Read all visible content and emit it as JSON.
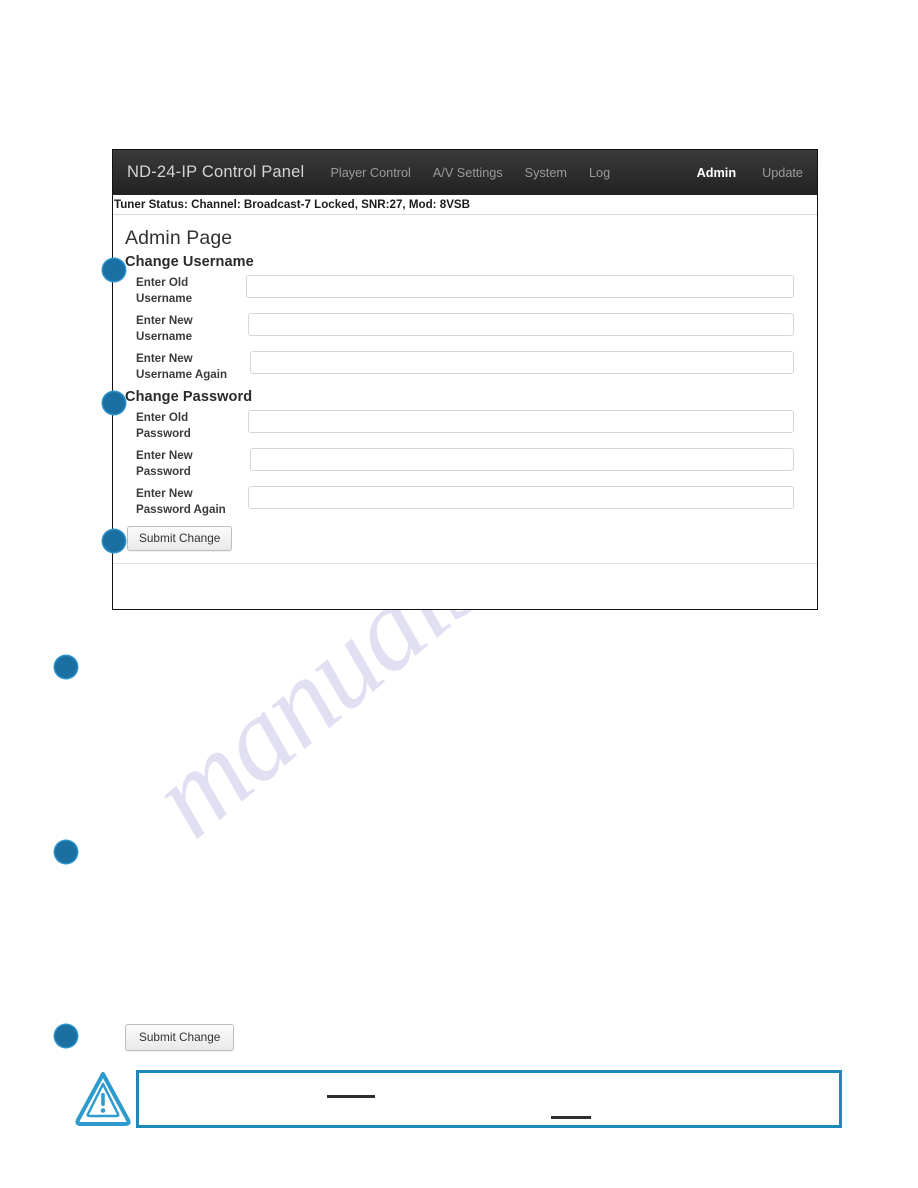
{
  "navbar": {
    "brand": "ND-24-IP Control Panel",
    "items": [
      {
        "label": "Player Control",
        "active": false
      },
      {
        "label": "A/V Settings",
        "active": false
      },
      {
        "label": "System",
        "active": false
      },
      {
        "label": "Log",
        "active": false
      }
    ],
    "right_items": [
      {
        "label": "Admin",
        "active": true
      },
      {
        "label": "Update",
        "active": false
      }
    ]
  },
  "statusbar": {
    "text": "Tuner Status: Channel: Broadcast-7 Locked, SNR:27, Mod: 8VSB"
  },
  "page": {
    "title": "Admin Page"
  },
  "sections": {
    "username": {
      "title": "Change Username",
      "fields": [
        {
          "label": "Enter Old Username",
          "value": "",
          "placeholder": ""
        },
        {
          "label": "Enter New Username",
          "value": "",
          "placeholder": ""
        },
        {
          "label": "Enter New Username Again",
          "value": "",
          "placeholder": ""
        }
      ]
    },
    "password": {
      "title": "Change Password",
      "fields": [
        {
          "label": "Enter Old Password",
          "value": "",
          "placeholder": ""
        },
        {
          "label": "Enter New Password",
          "value": "",
          "placeholder": ""
        },
        {
          "label": "Enter New Password Again",
          "value": "",
          "placeholder": ""
        }
      ]
    }
  },
  "submit_button": {
    "label": "Submit Change"
  },
  "lower_submit_button": {
    "label": "Submit Change"
  },
  "note": {
    "icon": "warning-triangle-icon",
    "text": ""
  },
  "watermark": {
    "text": "manualshive.com"
  },
  "colors": {
    "navbar_bg": "#2b2b2b",
    "callout_blue": "#1c6fa3",
    "note_border": "#1b8ab9",
    "watermark": "#c9c6e8"
  }
}
